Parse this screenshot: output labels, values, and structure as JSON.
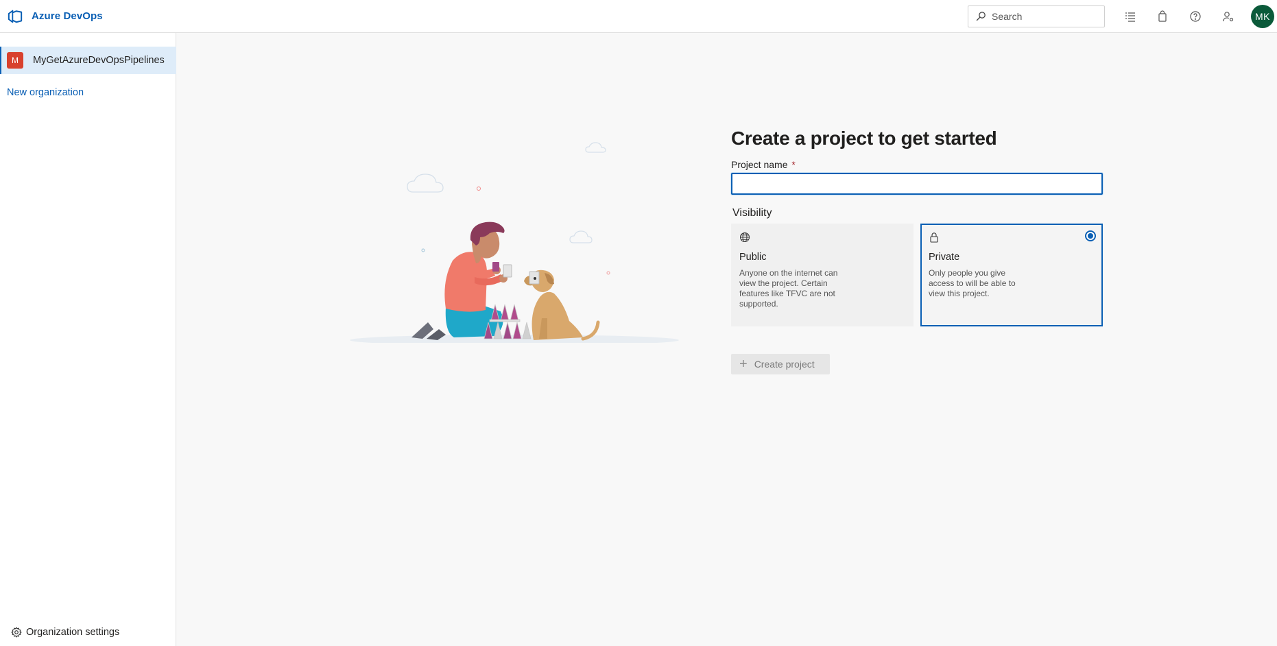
{
  "header": {
    "brand": "Azure DevOps",
    "search_placeholder": "Search",
    "avatar_initials": "MK",
    "icons": [
      "list-icon",
      "shopping-bag-icon",
      "help-icon",
      "user-settings-icon"
    ]
  },
  "sidebar": {
    "org_badge": "M",
    "org_name": "MyGetAzureDevOpsPipelines",
    "new_org": "New organization",
    "settings": "Organization settings"
  },
  "main": {
    "title": "Create a project to get started",
    "project_name_label": "Project name",
    "required_mark": "*",
    "project_name_value": "",
    "visibility_label": "Visibility",
    "options": [
      {
        "title": "Public",
        "description": "Anyone on the internet can view the project. Certain features like TFVC are not supported.",
        "selected": false
      },
      {
        "title": "Private",
        "description": "Only people you give access to will be able to view this project.",
        "selected": true
      }
    ],
    "create_button": "Create project"
  },
  "colors": {
    "accent": "#0a5fb4",
    "org_badge": "#d8412e",
    "avatar": "#0b5a3a"
  }
}
